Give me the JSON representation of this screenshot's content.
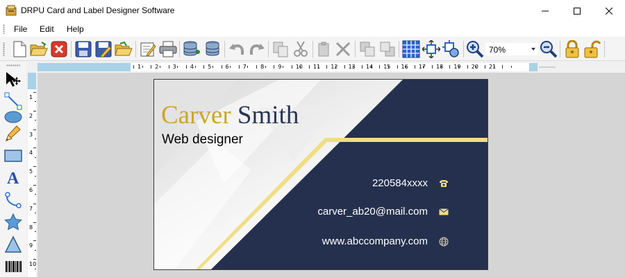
{
  "window": {
    "title": "DRPU Card and Label Designer Software"
  },
  "menu": {
    "file": "File",
    "edit": "Edit",
    "help": "Help"
  },
  "toolbar": {
    "zoom_value": "70%"
  },
  "ruler": {
    "horizontal_labels": [
      "1",
      "2",
      "3",
      "4",
      "5",
      "6",
      "7",
      "8",
      "9",
      "10",
      "11",
      "12",
      "13",
      "14",
      "15",
      "16",
      "17",
      "18",
      "19",
      "20",
      "21"
    ],
    "vertical_labels": [
      "1",
      "2",
      "3",
      "4",
      "5",
      "6",
      "7",
      "8",
      "9",
      "10"
    ]
  },
  "card": {
    "first_name": "Carver",
    "last_name": "Smith",
    "role": "Web designer",
    "phone": "220584xxxx",
    "email": "carver_ab20@mail.com",
    "website": "www.abccompany.com",
    "colors": {
      "navy": "#24304d",
      "gold": "#c9a727",
      "accent_line": "#f0de84"
    }
  }
}
